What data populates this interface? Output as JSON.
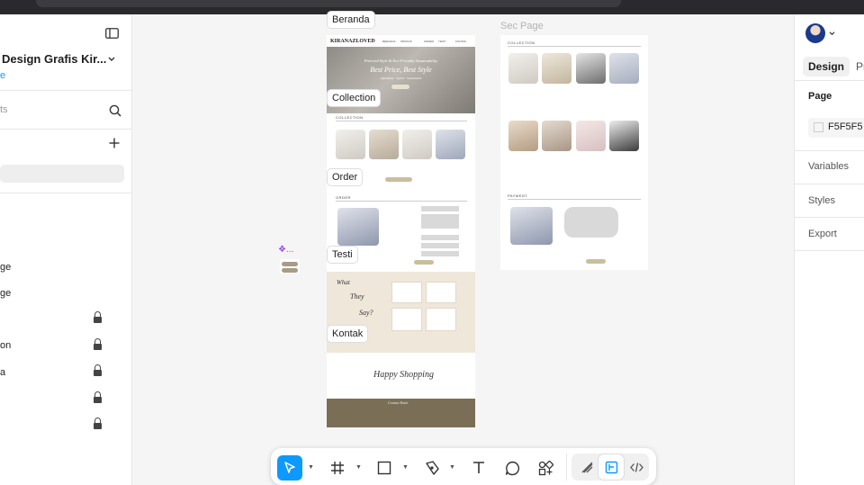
{
  "left_panel": {
    "file_name": "Design Grafis Kir...",
    "file_sub": "e",
    "assets_search": "ts",
    "layers": [
      "ge",
      "ge",
      "",
      "on",
      "a",
      "",
      ""
    ]
  },
  "canvas": {
    "frame_labels": {
      "beranda": "Beranda",
      "collection": "Collection",
      "order": "Order",
      "testi": "Testi",
      "kontak": "Kontak"
    },
    "sec_page_title": "Sec Page",
    "component_label": "❖...",
    "mockup": {
      "logo": "KIRANAZLOVED",
      "nav": [
        "BERANDA",
        "PRODUK",
        "ORDER",
        "TESTI",
        "KONTAK"
      ],
      "hero_line1": "Preloved Style & Eco-Friendly Sustainability",
      "hero_line2": "Best Price, Best Style",
      "hero_line3": "Affordable · Stylish · Sustainable",
      "section_collection": "COLLECTION",
      "section_order": "ORDER",
      "section_payment": "PAYMENT",
      "testi_what": "What",
      "testi_they": "They",
      "testi_say": "Say?",
      "happy": "Happy Shopping",
      "contact": "Contact Kami",
      "see_all": "SEE ALL",
      "payment_btn": "PAYMENT",
      "konfirmasi_btn": "KONFIRMASI"
    }
  },
  "right_panel": {
    "tabs": [
      "Design",
      "Pr"
    ],
    "page_label": "Page",
    "page_color": "F5F5F5",
    "sections": [
      "Variables",
      "Styles",
      "Export"
    ]
  },
  "toolbar": {
    "tools": [
      "move-tool",
      "frame-tool",
      "rectangle-tool",
      "pen-tool",
      "text-tool",
      "comment-tool",
      "actions-tool"
    ],
    "right_tools": [
      "draw-mode",
      "design-mode",
      "dev-mode"
    ]
  },
  "colors": {
    "accent": "#0d99ff",
    "footer": "#7a6e56",
    "beige": "#efe7da"
  }
}
